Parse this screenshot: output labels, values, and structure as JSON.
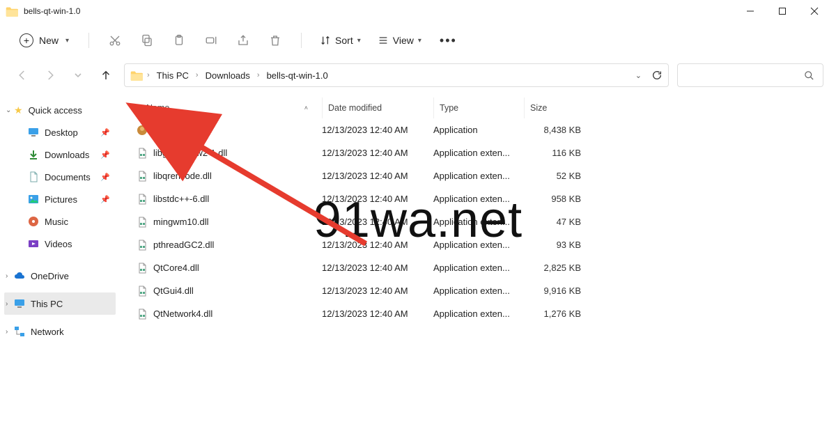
{
  "window": {
    "title": "bells-qt-win-1.0"
  },
  "toolbar": {
    "new_label": "New",
    "sort_label": "Sort",
    "view_label": "View"
  },
  "breadcrumb": {
    "items": [
      "This PC",
      "Downloads",
      "bells-qt-win-1.0"
    ]
  },
  "sidebar": {
    "quick_access": "Quick access",
    "desktop": "Desktop",
    "downloads": "Downloads",
    "documents": "Documents",
    "pictures": "Pictures",
    "music": "Music",
    "videos": "Videos",
    "onedrive": "OneDrive",
    "this_pc": "This PC",
    "network": "Network"
  },
  "columns": {
    "name": "Name",
    "modified": "Date modified",
    "type": "Type",
    "size": "Size"
  },
  "files": [
    {
      "name": "bells-qt",
      "modified": "12/13/2023 12:40 AM",
      "type": "Application",
      "size": "8,438 KB",
      "kind": "app"
    },
    {
      "name": "libgcc_s_dw2-1.dll",
      "modified": "12/13/2023 12:40 AM",
      "type": "Application exten...",
      "size": "116 KB",
      "kind": "dll"
    },
    {
      "name": "libqrencode.dll",
      "modified": "12/13/2023 12:40 AM",
      "type": "Application exten...",
      "size": "52 KB",
      "kind": "dll"
    },
    {
      "name": "libstdc++-6.dll",
      "modified": "12/13/2023 12:40 AM",
      "type": "Application exten...",
      "size": "958 KB",
      "kind": "dll"
    },
    {
      "name": "mingwm10.dll",
      "modified": "12/13/2023 12:40 AM",
      "type": "Application exten...",
      "size": "47 KB",
      "kind": "dll"
    },
    {
      "name": "pthreadGC2.dll",
      "modified": "12/13/2023 12:40 AM",
      "type": "Application exten...",
      "size": "93 KB",
      "kind": "dll"
    },
    {
      "name": "QtCore4.dll",
      "modified": "12/13/2023 12:40 AM",
      "type": "Application exten...",
      "size": "2,825 KB",
      "kind": "dll"
    },
    {
      "name": "QtGui4.dll",
      "modified": "12/13/2023 12:40 AM",
      "type": "Application exten...",
      "size": "9,916 KB",
      "kind": "dll"
    },
    {
      "name": "QtNetwork4.dll",
      "modified": "12/13/2023 12:40 AM",
      "type": "Application exten...",
      "size": "1,276 KB",
      "kind": "dll"
    }
  ],
  "watermark": "91wa.net"
}
